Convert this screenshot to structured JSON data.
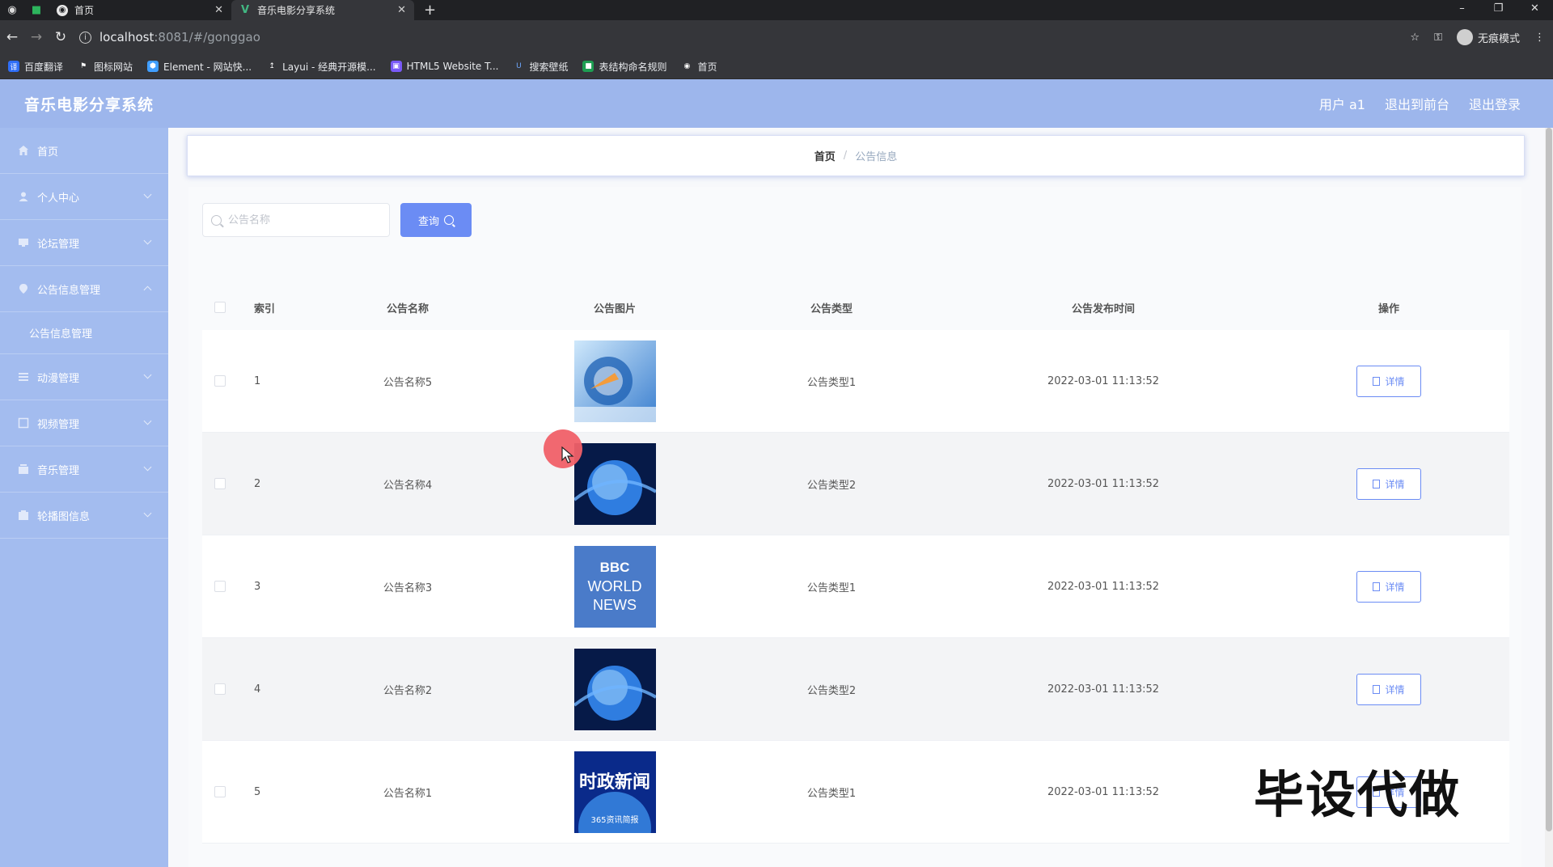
{
  "browser": {
    "tabs": [
      {
        "label": "首页"
      },
      {
        "label": "音乐电影分享系统"
      }
    ],
    "url_host": "localhost",
    "url_path": ":8081/#/gonggao",
    "incognito_label": "无痕模式",
    "bookmarks": [
      {
        "label": "百度翻译"
      },
      {
        "label": "图标网站"
      },
      {
        "label": "Element - 网站快..."
      },
      {
        "label": "Layui - 经典开源模..."
      },
      {
        "label": "HTML5 Website T..."
      },
      {
        "label": "搜索壁纸"
      },
      {
        "label": "表结构命名规则"
      },
      {
        "label": "首页"
      }
    ]
  },
  "app": {
    "title": "音乐电影分享系统",
    "header_links": {
      "user": "用户 a1",
      "back_front": "退出到前台",
      "logout": "退出登录"
    }
  },
  "sidebar": {
    "items": [
      {
        "label": "首页",
        "icon": "home-icon"
      },
      {
        "label": "个人中心",
        "icon": "user-icon"
      },
      {
        "label": "论坛管理",
        "icon": "forum-icon"
      },
      {
        "label": "公告信息管理",
        "icon": "notice-icon"
      },
      {
        "label": "动漫管理",
        "icon": "anime-icon"
      },
      {
        "label": "视频管理",
        "icon": "video-icon"
      },
      {
        "label": "音乐管理",
        "icon": "music-icon"
      },
      {
        "label": "轮播图信息",
        "icon": "carousel-icon"
      }
    ],
    "submenu": {
      "label": "公告信息管理"
    }
  },
  "breadcrumb": {
    "home": "首页",
    "separator": "/",
    "current": "公告信息"
  },
  "search": {
    "placeholder": "公告名称",
    "value": "",
    "button_label": "查询"
  },
  "table": {
    "headers": {
      "index": "索引",
      "name": "公告名称",
      "image": "公告图片",
      "type": "公告类型",
      "time": "公告发布时间",
      "op": "操作"
    },
    "detail_label": "详情",
    "rows": [
      {
        "index": "1",
        "name": "公告名称5",
        "type": "公告类型1",
        "time": "2022-03-01 11:13:52",
        "image": "news-globe-image"
      },
      {
        "index": "2",
        "name": "公告名称4",
        "type": "公告类型2",
        "time": "2022-03-01 11:13:52",
        "image": "earth-blue-image"
      },
      {
        "index": "3",
        "name": "公告名称3",
        "type": "公告类型1",
        "time": "2022-03-01 11:13:52",
        "image": "bbc-world-news-image",
        "image_text": [
          "BBC",
          "WORLD",
          "NEWS"
        ]
      },
      {
        "index": "4",
        "name": "公告名称2",
        "type": "公告类型2",
        "time": "2022-03-01 11:13:52",
        "image": "earth-blue-image"
      },
      {
        "index": "5",
        "name": "公告名称1",
        "type": "公告类型1",
        "time": "2022-03-01 11:13:52",
        "image": "shizheng-news-image",
        "image_text": [
          "时政新闻",
          "365资讯简报"
        ]
      }
    ]
  },
  "watermark": "毕设代做",
  "colors": {
    "header": "#9db6ec",
    "sidebar": "#a3bcef",
    "accent": "#6b8cf4"
  }
}
